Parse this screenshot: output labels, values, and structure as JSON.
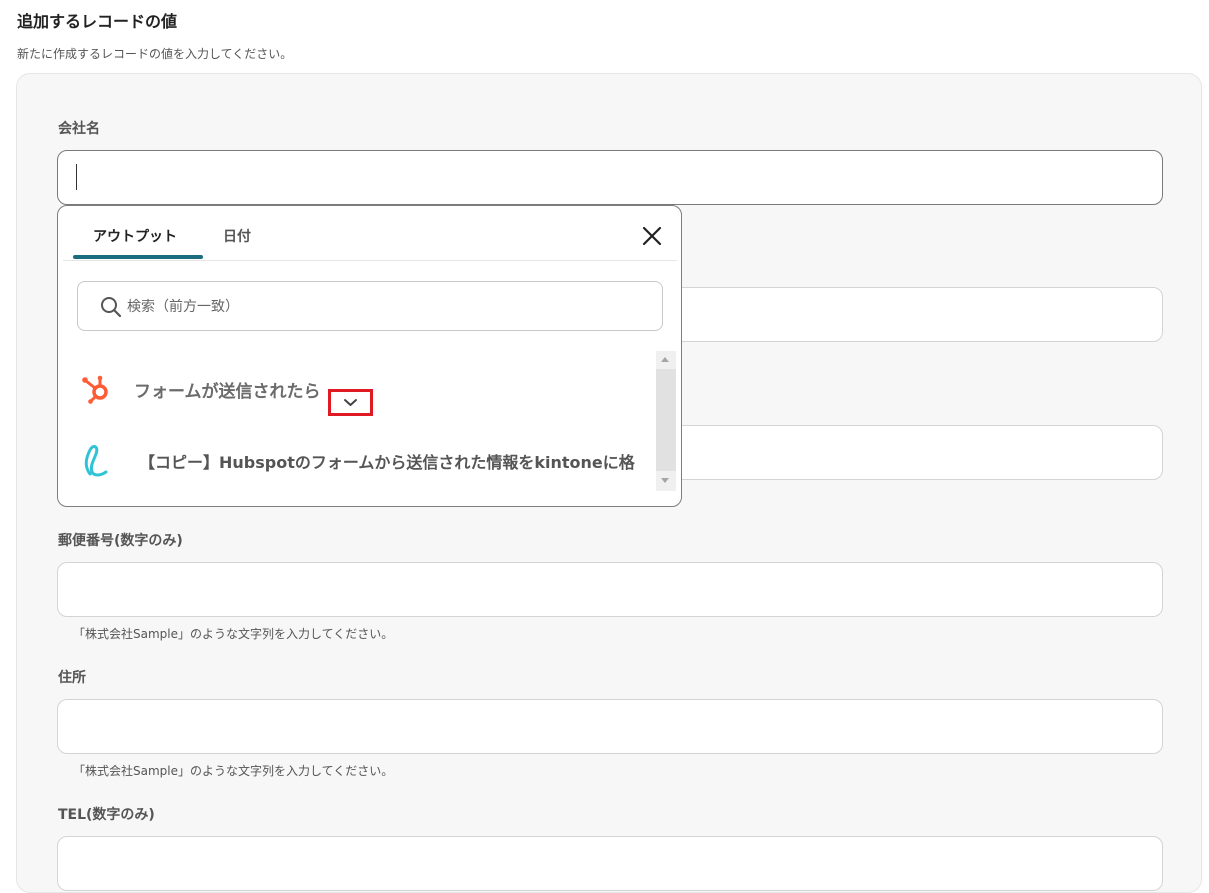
{
  "section": {
    "title": "追加するレコードの値",
    "description": "新たに作成するレコードの値を入力してください。"
  },
  "fields": {
    "company": {
      "label": "会社名",
      "value": ""
    },
    "postal": {
      "label": "郵便番号(数字のみ)",
      "hint": "「株式会社Sample」のような文字列を入力してください。"
    },
    "address": {
      "label": "住所",
      "hint": "「株式会社Sample」のような文字列を入力してください。"
    },
    "tel": {
      "label": "TEL(数字のみ)"
    }
  },
  "popup": {
    "tabs": [
      {
        "label": "アウトプット",
        "active": true
      },
      {
        "label": "日付",
        "active": false
      }
    ],
    "search_placeholder": "検索（前方一致）",
    "items": [
      {
        "label": "フォームが送信されたら",
        "icon": "hubspot-icon",
        "icon_color": "#ff5c35"
      },
      {
        "label": "【コピー】Hubspotのフォームから送信された情報をkintoneに格",
        "icon": "yoom-icon",
        "icon_color": "#2ec4d6"
      }
    ]
  },
  "colors": {
    "accent": "#1b6d80",
    "highlight_box": "#e01a22",
    "panel_bg": "#f7f7f7"
  }
}
